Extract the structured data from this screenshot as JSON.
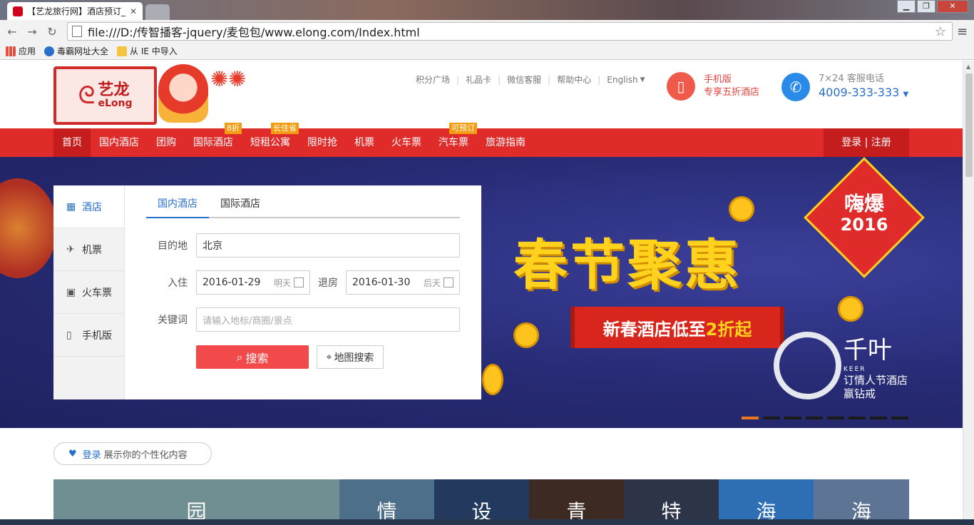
{
  "browser": {
    "tab_title": "【艺龙旅行网】酒店预订_",
    "tab_close": "✕",
    "url": "file:///D:/传智播客-jquery/麦包包/www.elong.com/Index.html",
    "bookmarks": [
      {
        "label": "应用",
        "icon": "apps-grid-icon",
        "color": "#e74c3c"
      },
      {
        "label": "毒霸网址大全",
        "icon": "duba-k-icon",
        "color": "#2a6fc9"
      },
      {
        "label": "从 IE 中导入",
        "icon": "folder-icon",
        "color": "#f5c342"
      }
    ]
  },
  "header": {
    "logo_cn": "艺龙",
    "logo_en": "eLong",
    "top_links": [
      "积分广场",
      "礼品卡",
      "微信客服",
      "帮助中心",
      "English"
    ],
    "mobile": {
      "line1": "手机版",
      "line2": "专享五折酒店"
    },
    "service": {
      "line1": "7×24 客服电话",
      "line2": "4009-333-333"
    }
  },
  "nav": {
    "items": [
      {
        "label": "首页",
        "tag": ""
      },
      {
        "label": "国内酒店",
        "tag": ""
      },
      {
        "label": "团购",
        "tag": ""
      },
      {
        "label": "国际酒店",
        "tag": "8折"
      },
      {
        "label": "短租公寓",
        "tag": "长住省"
      },
      {
        "label": "限时抢",
        "tag": ""
      },
      {
        "label": "机票",
        "tag": ""
      },
      {
        "label": "火车票",
        "tag": ""
      },
      {
        "label": "汽车票",
        "tag": "可预订"
      },
      {
        "label": "旅游指南",
        "tag": ""
      }
    ],
    "login": "登录 | 注册"
  },
  "search": {
    "side": [
      {
        "label": "酒店",
        "icon": "hotel-icon"
      },
      {
        "label": "机票",
        "icon": "plane-icon"
      },
      {
        "label": "火车票",
        "icon": "train-icon"
      },
      {
        "label": "手机版",
        "icon": "mobile-icon"
      }
    ],
    "tabs": [
      "国内酒店",
      "国际酒店"
    ],
    "dest_label": "目的地",
    "dest_value": "北京",
    "checkin_label": "入住",
    "checkin_value": "2016-01-29",
    "checkin_hint": "明天",
    "checkout_label": "退房",
    "checkout_value": "2016-01-30",
    "checkout_hint": "后天",
    "keyword_label": "关键词",
    "keyword_placeholder": "请输入地标/商圈/景点",
    "search_btn": "搜索",
    "map_btn": "地图搜索"
  },
  "banner": {
    "headline": "春节聚惠",
    "ribbon_a": "新春酒店低至",
    "ribbon_b": "2折起",
    "badge_a": "嗨爆",
    "badge_b": "2016",
    "brand": "千叶",
    "brand_en": "KEER",
    "promo_a": "订情人节酒店",
    "promo_b": "赢钻戒",
    "active_slide": 0,
    "slide_count": 8
  },
  "personal": {
    "link": "登录",
    "text": "展示你的个性化内容"
  },
  "tiles": [
    {
      "char": "园",
      "color": "#6f8f93"
    },
    {
      "char": "情",
      "color": "#4d6f8a"
    },
    {
      "char": "设",
      "color": "#233a5e"
    },
    {
      "char": "青",
      "color": "#3d2a22"
    },
    {
      "char": "特",
      "color": "#2e3448"
    },
    {
      "char": "海",
      "color": "#2d6eb5"
    },
    {
      "char": "海",
      "color": "#5e7494"
    }
  ]
}
